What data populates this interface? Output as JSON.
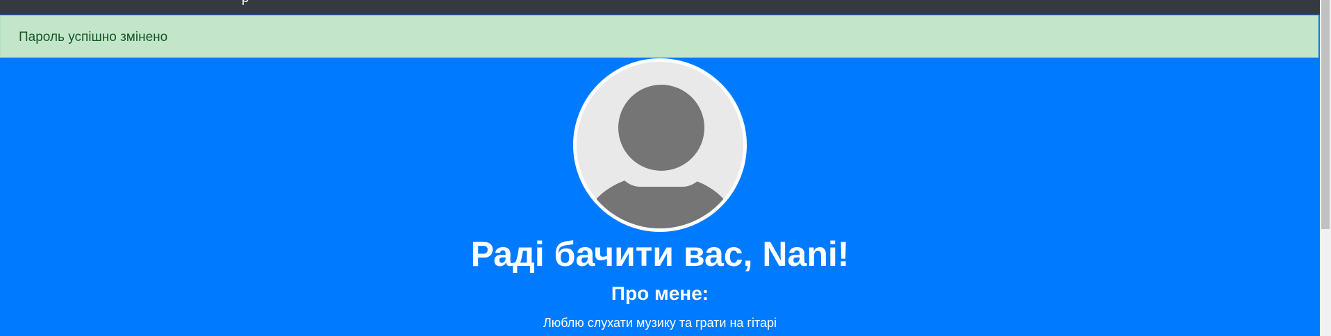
{
  "navbar": {
    "fragment": "p"
  },
  "alert": {
    "message": "Пароль успішно змінено"
  },
  "profile": {
    "greeting": "Раді бачити вас, Nani!",
    "about_heading": "Про мене:",
    "about_text": "Люблю слухати музику та грати на гітарі"
  },
  "colors": {
    "hero": "#007bff",
    "navbar": "#343a40",
    "alert_bg": "#c3e6cb",
    "alert_text": "#155724",
    "avatar_bg": "#e9e9e9",
    "avatar_fg": "#757575"
  },
  "icons": {
    "avatar": "user-silhouette-icon"
  }
}
